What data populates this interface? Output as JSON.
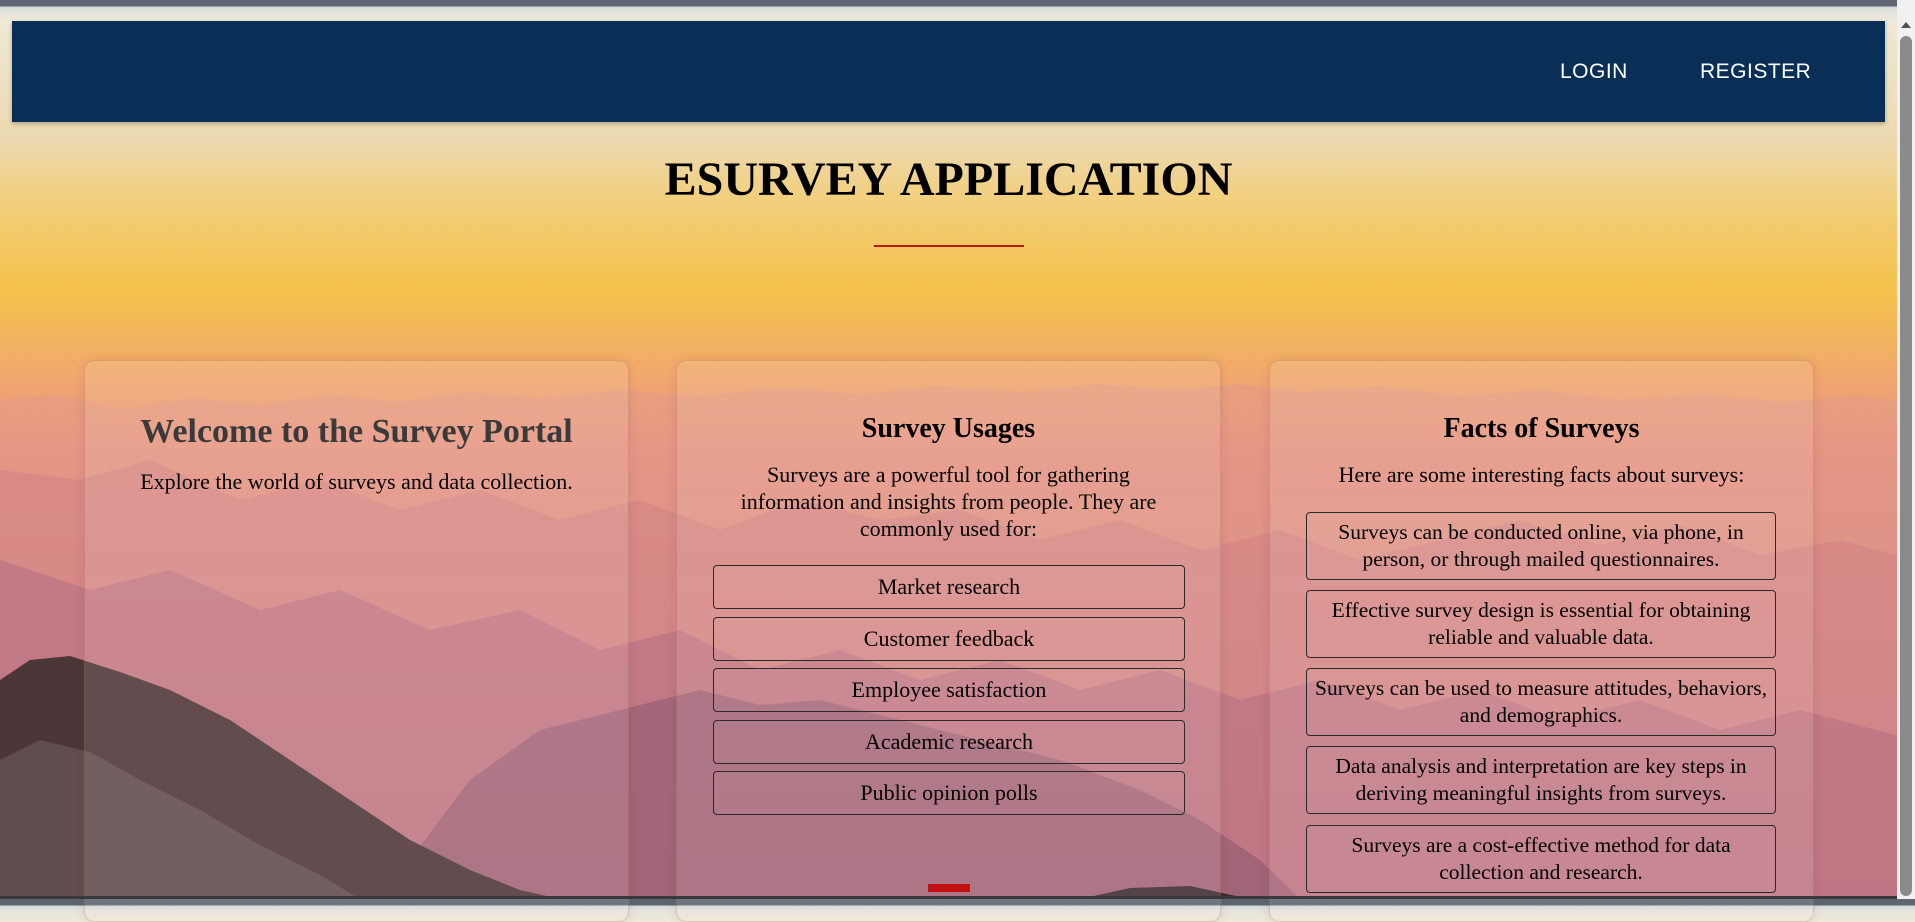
{
  "nav": {
    "login_label": "LOGIN",
    "register_label": "REGISTER"
  },
  "page": {
    "title": "ESURVEY APPLICATION"
  },
  "welcome": {
    "title": "Welcome to the Survey Portal",
    "subtitle": "Explore the world of surveys and data collection."
  },
  "usages": {
    "title": "Survey Usages",
    "intro": "Surveys are a powerful tool for gathering information and insights from people. They are commonly used for:",
    "items": [
      "Market research",
      "Customer feedback",
      "Employee satisfaction",
      "Academic research",
      "Public opinion polls"
    ]
  },
  "facts": {
    "title": "Facts of Surveys",
    "intro": "Here are some interesting facts about surveys:",
    "items": [
      "Surveys can be conducted online, via phone, in person, or through mailed questionnaires.",
      "Effective survey design is essential for obtaining reliable and valuable data.",
      "Surveys can be used to measure attitudes, behaviors, and demographics.",
      "Data analysis and interpretation are key steps in deriving meaningful insights from surveys.",
      "Surveys are a cost-effective method for data collection and research."
    ]
  },
  "colors": {
    "navbar": "#0a2f56",
    "accent_red": "#b41a1a"
  }
}
